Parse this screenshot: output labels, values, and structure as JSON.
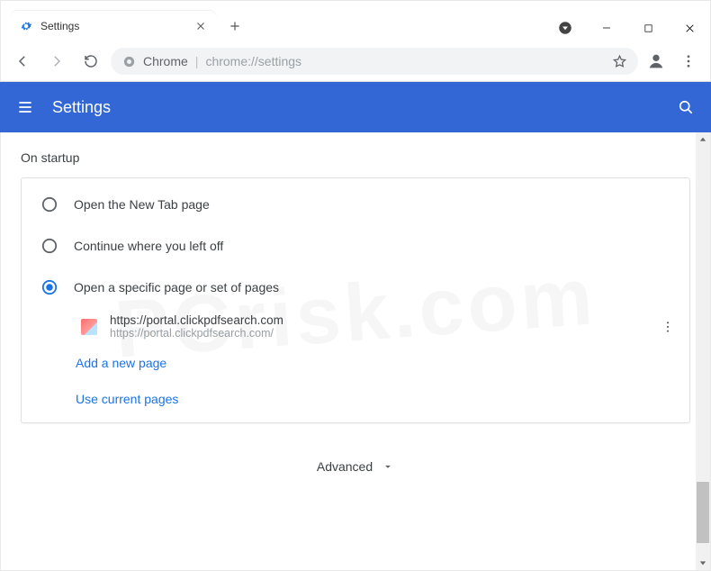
{
  "window": {
    "tab_title": "Settings"
  },
  "addressbar": {
    "chip": "Chrome",
    "url": "chrome://settings"
  },
  "appbar": {
    "title": "Settings"
  },
  "section": {
    "title": "On startup",
    "options": [
      {
        "label": "Open the New Tab page",
        "selected": false
      },
      {
        "label": "Continue where you left off",
        "selected": false
      },
      {
        "label": "Open a specific page or set of pages",
        "selected": true
      }
    ],
    "page": {
      "title": "https://portal.clickpdfsearch.com",
      "url": "https://portal.clickpdfsearch.com/"
    },
    "add_page": "Add a new page",
    "use_current": "Use current pages"
  },
  "footer": {
    "advanced": "Advanced"
  },
  "colors": {
    "accent": "#1a73e8",
    "appbar": "#3367d6"
  },
  "watermark": "PCrisk.com"
}
